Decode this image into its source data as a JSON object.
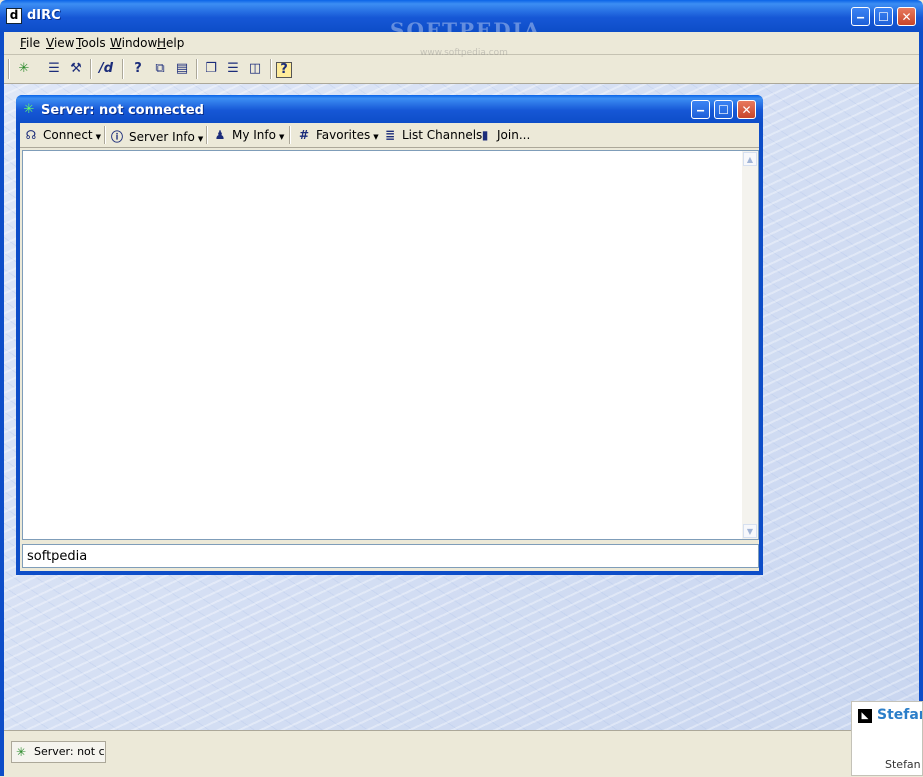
{
  "window": {
    "title": "dIRC",
    "icon_letter": "d",
    "minimize_glyph": "‒",
    "maximize_glyph": "☐",
    "close_glyph": "✕",
    "watermark": "SOFTPEDIA",
    "watermark_url": "www.softpedia.com"
  },
  "menu": [
    {
      "label": "File",
      "mnemonic": "F",
      "rest": "ile"
    },
    {
      "label": "View",
      "mnemonic": "V",
      "rest": "iew"
    },
    {
      "label": "Tools",
      "mnemonic": "T",
      "rest": "ools"
    },
    {
      "label": "Window",
      "mnemonic": "W",
      "rest": "indow"
    },
    {
      "label": "Help",
      "mnemonic": "H",
      "rest": "elp"
    }
  ],
  "toolbar": {
    "new_connection_icon": "✳",
    "options_icon": "☰",
    "tools_icon": "⚒",
    "command_label": "/d",
    "whois_icon": "?",
    "window_list_icon": "⧉",
    "message_icon": "▤",
    "cascade_icon": "❐",
    "tile_horizontal_icon": "☰",
    "tile_vertical_icon": "◫",
    "help_icon": "?"
  },
  "server_window": {
    "title": "Server: not connected",
    "toolbar": {
      "connect": "Connect",
      "server_info": "Server Info",
      "my_info": "My Info",
      "favorites": "Favorites",
      "list_channels": "List Channels",
      "join": "Join..."
    },
    "input_value": "softpedia",
    "scroll_up_glyph": "▲",
    "scroll_down_glyph": "▼"
  },
  "statusbar": {
    "task_label": "Server: not connected"
  },
  "popup": {
    "title": "Stefan",
    "subtitle": "Stefan F"
  },
  "colors": {
    "titlebar": "#0d4dc8",
    "close_button": "#c8452a",
    "workspace": "#c9d6f0",
    "popup_title": "#2b7ec9"
  }
}
